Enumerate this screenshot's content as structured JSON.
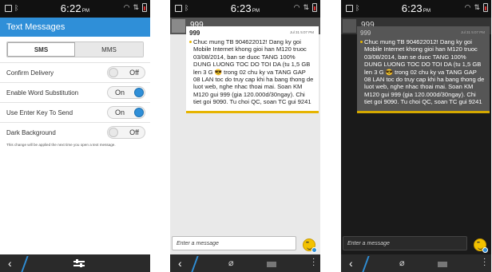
{
  "screens": [
    {
      "status": {
        "time": "6:22",
        "ampm": "PM"
      },
      "title": "Text Messages",
      "tabs": [
        "SMS",
        "MMS"
      ],
      "settings": [
        {
          "label": "Confirm Delivery",
          "state": "Off"
        },
        {
          "label": "Enable Word Substitution",
          "state": "On"
        },
        {
          "label": "Use Enter Key To Send",
          "state": "On"
        },
        {
          "label": "Dark Background",
          "state": "Off"
        }
      ],
      "note": "This change will be applied the next time you open a text message."
    },
    {
      "status": {
        "time": "6:23",
        "ampm": "PM"
      },
      "contact": "999",
      "message": {
        "sender": "999",
        "time": "Jul 31 5:07 PM",
        "text": "Chuc mung TB 904622012! Dang ky goi Mobile Internet khong gioi han M120 truoc 03/08/2014, ban se duoc TANG 100% DUNG LUONG TOC DO TOI DA (tu 1,5 GB len 3 G 😎 trong 02 chu ky va TANG GAP 08 LAN toc do truy cap khi ha bang thong de luot web, nghe nhac thoai mai. Soan KM M120 gui 999 (gia 120.000d/30ngay). Chi tiet goi 9090. Tu choi QC, soan TC gui 9241"
      },
      "compose_placeholder": "Enter a message"
    },
    {
      "status": {
        "time": "6:23",
        "ampm": "PM"
      },
      "contact": "999",
      "message": {
        "sender": "999",
        "time": "Jul 31 5:07 PM",
        "text": "Chuc mung TB 904622012! Dang ky goi Mobile Internet khong gioi han M120 truoc 03/08/2014, ban se duoc TANG 100% DUNG LUONG TOC DO TOI DA (tu 1,5 GB len 3 G 😎 trong 02 chu ky va TANG GAP 08 LAN toc do truy cap khi ha bang thong de luot web, nghe nhac thoai mai. Soan KM M120 gui 999 (gia 120.000d/30ngay). Chi tiet goi 9090. Tu choi QC, soan TC gui 9241"
      },
      "compose_placeholder": "Enter a message"
    }
  ],
  "colors": {
    "accent": "#2f8fd8",
    "bubble_stripe": "#e6b400",
    "dark_bg": "#1a1a1a"
  }
}
